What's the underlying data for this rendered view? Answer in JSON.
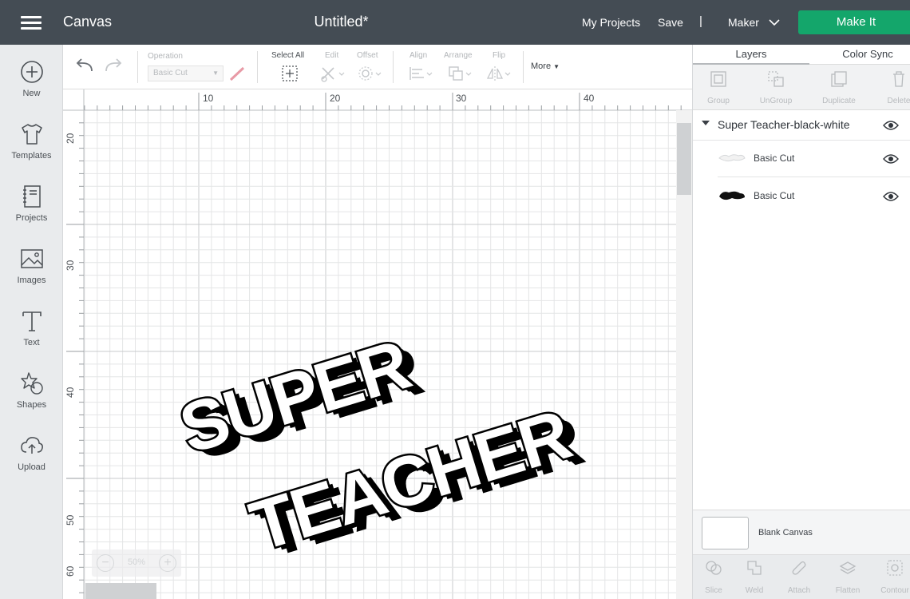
{
  "topbar": {
    "app_name": "Canvas",
    "doc_title": "Untitled*",
    "my_projects": "My Projects",
    "save": "Save",
    "divider": "|",
    "machine": "Maker",
    "make_it": "Make It"
  },
  "sidebar": {
    "items": [
      {
        "label": "New",
        "icon": "plus-circle-icon"
      },
      {
        "label": "Templates",
        "icon": "tshirt-icon"
      },
      {
        "label": "Projects",
        "icon": "notebook-icon"
      },
      {
        "label": "Images",
        "icon": "image-icon"
      },
      {
        "label": "Text",
        "icon": "text-T-icon"
      },
      {
        "label": "Shapes",
        "icon": "shapes-icon"
      },
      {
        "label": "Upload",
        "icon": "cloud-upload-icon"
      }
    ]
  },
  "toolbar": {
    "operation_label": "Operation",
    "operation_value": "Basic Cut",
    "select_all": "Select All",
    "edit": "Edit",
    "offset": "Offset",
    "align": "Align",
    "arrange": "Arrange",
    "flip": "Flip",
    "more": "More"
  },
  "canvas": {
    "ruler_top": [
      "10",
      "20",
      "30",
      "40"
    ],
    "ruler_left": [
      "20",
      "30",
      "40",
      "50",
      "60"
    ],
    "zoom_level": "50%",
    "zoom_minus": "−",
    "zoom_plus": "+",
    "artwork_text": [
      "SUPER",
      "TEACHER"
    ]
  },
  "right_panel": {
    "tabs": [
      "Layers",
      "Color Sync"
    ],
    "layer_tools": [
      "Group",
      "UnGroup",
      "Duplicate",
      "Delete"
    ],
    "group_name": "Super Teacher-black-white",
    "layers": [
      {
        "name": "Basic Cut",
        "color": "#ffffff"
      },
      {
        "name": "Basic Cut",
        "color": "#000000"
      }
    ],
    "blank_canvas": "Blank Canvas",
    "bottom_tools": [
      "Slice",
      "Weld",
      "Attach",
      "Flatten",
      "Contour"
    ]
  },
  "colors": {
    "topbar": "#444c54",
    "make_it": "#14a66b",
    "sidebar": "#e9ebed"
  }
}
